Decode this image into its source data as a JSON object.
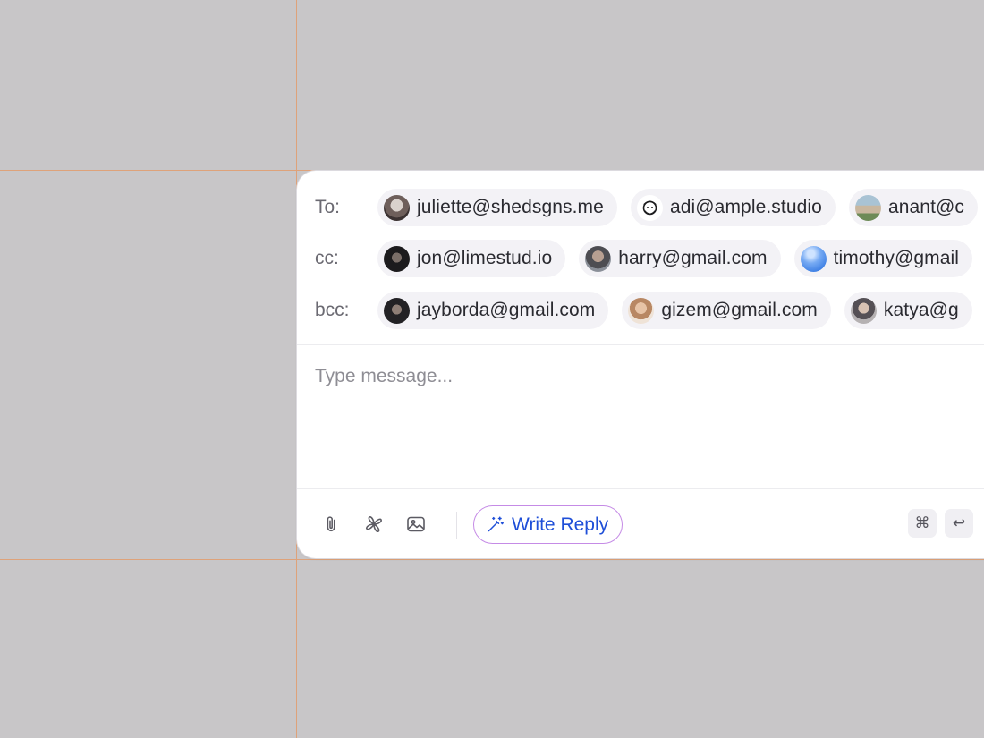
{
  "recipients": {
    "to": {
      "label": "To:",
      "chips": [
        {
          "email": "juliette@shedsgns.me"
        },
        {
          "email": "adi@ample.studio"
        },
        {
          "email": "anant@c"
        }
      ]
    },
    "cc": {
      "label": "cc:",
      "chips": [
        {
          "email": "jon@limestud.io"
        },
        {
          "email": "harry@gmail.com"
        },
        {
          "email": "timothy@gmail"
        }
      ]
    },
    "bcc": {
      "label": "bcc:",
      "chips": [
        {
          "email": "jayborda@gmail.com"
        },
        {
          "email": "gizem@gmail.com"
        },
        {
          "email": "katya@g"
        }
      ]
    }
  },
  "message": {
    "placeholder": "Type message..."
  },
  "toolbar": {
    "icons": [
      "paperclip-icon",
      "pinwheel-icon",
      "image-icon"
    ],
    "write_reply_label": "Write Reply",
    "shortcut_keys": [
      "⌘",
      "↩"
    ]
  },
  "colors": {
    "background": "#c8c6c8",
    "guide_line": "#dea27a",
    "chip_bg": "#f3f2f6",
    "accent_text": "#1f4fd8",
    "accent_border": "#c58be6"
  }
}
